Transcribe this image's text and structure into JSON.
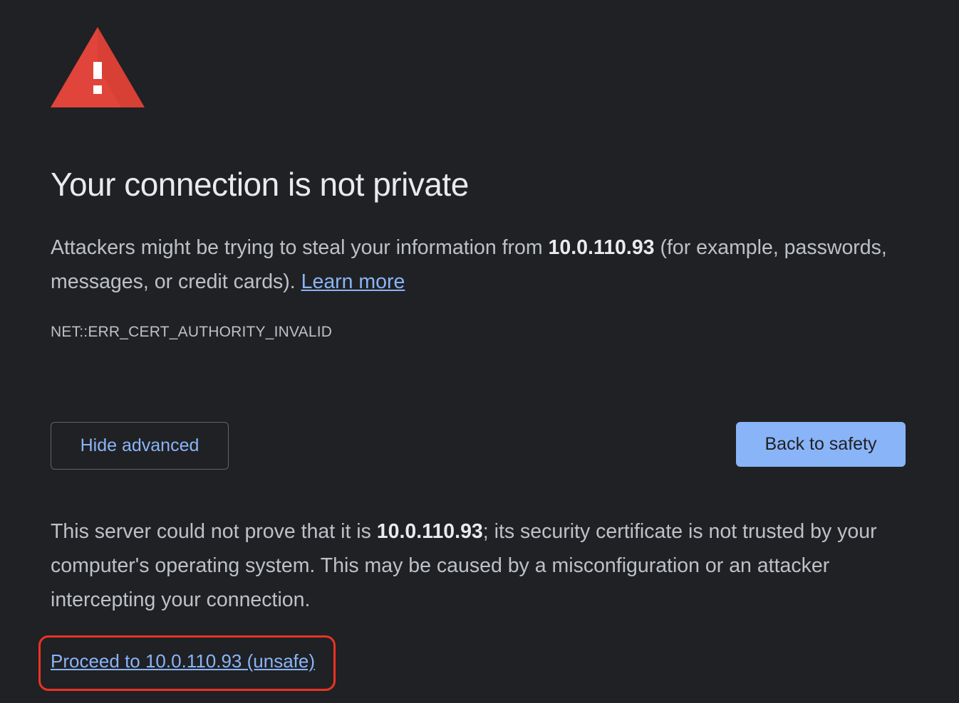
{
  "icon": "warning-triangle-icon",
  "heading": "Your connection is not private",
  "intro": {
    "before": "Attackers might be trying to steal your information from ",
    "host": "10.0.110.93",
    "after": " (for example, passwords, messages, or credit cards). ",
    "learn_more": "Learn more"
  },
  "error_code": "NET::ERR_CERT_AUTHORITY_INVALID",
  "buttons": {
    "hide_advanced": "Hide advanced",
    "back_to_safety": "Back to safety"
  },
  "details": {
    "before": "This server could not prove that it is ",
    "host": "10.0.110.93",
    "after": "; its security certificate is not trusted by your computer's operating system. This may be caused by a misconfiguration or an attacker intercepting your connection."
  },
  "proceed_link": "Proceed to 10.0.110.93 (unsafe)",
  "colors": {
    "background": "#202124",
    "accent": "#8ab4f8",
    "warning_red": "#e0443a",
    "highlight_red": "#ea3323"
  }
}
